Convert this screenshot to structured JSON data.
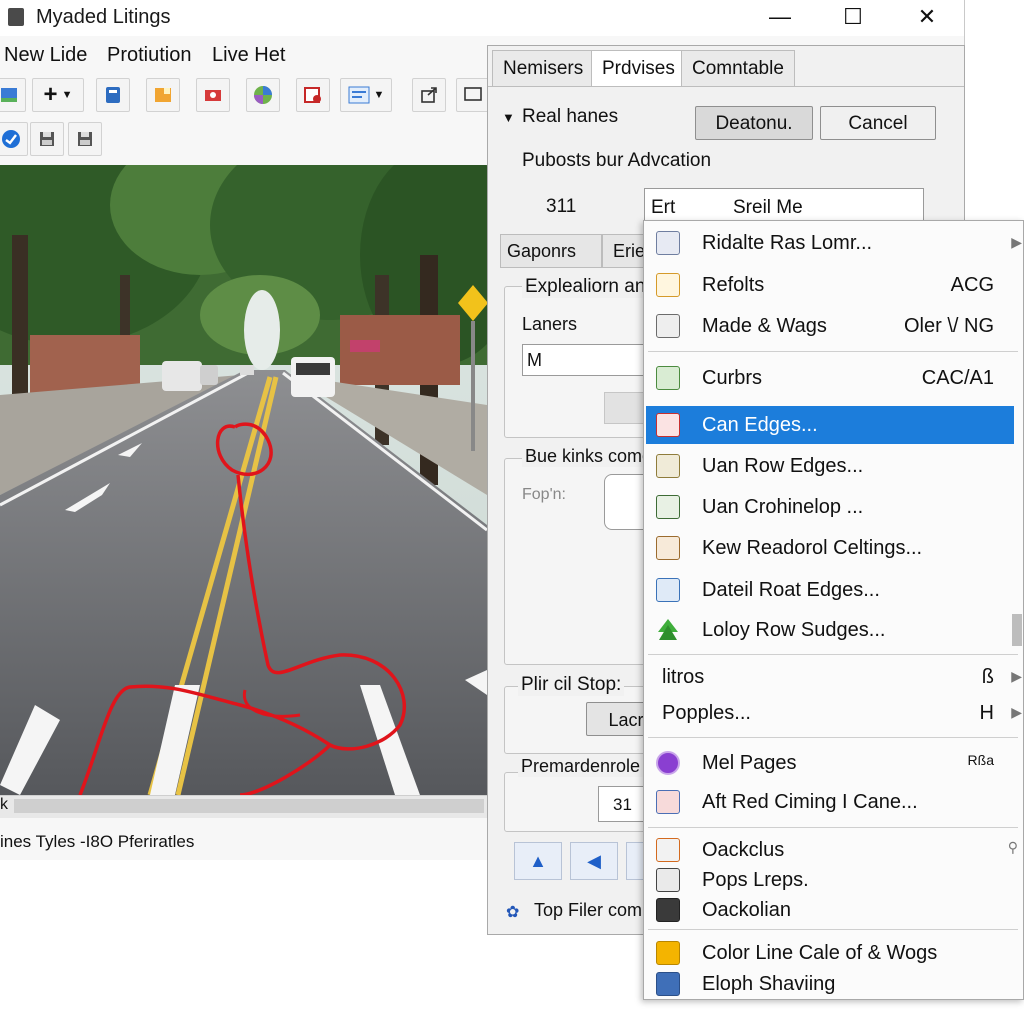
{
  "window": {
    "title": "Myaded Litings",
    "controls": {
      "minimize": "—",
      "maximize": "☐",
      "close": "✕"
    }
  },
  "menubar": [
    "New Lide",
    "Protiution",
    "Live Het"
  ],
  "status_bar": {
    "text": "ines Tyles -I8O Pferiratles",
    "scroll_left": "k"
  },
  "dialog": {
    "tabs": [
      "Nemisers",
      "Prdvises",
      "Comntable"
    ],
    "section_title": "Real hanes",
    "btn_primary": "Deatonu.",
    "btn_cancel": "Cancel",
    "subtitle": "Pubosts bur Advcation",
    "number_value": "311",
    "combo_left": "Ert",
    "combo_value": "Sreil Me",
    "subtabs": [
      "Gaponrs",
      "Erie"
    ],
    "group1_title": "Explealiorn an",
    "lanes_label": "Laners",
    "lanes_value": "M",
    "group2_title": "Bue kinks come",
    "fopn_label": "Fop'n:",
    "group3_title": "Plir cil Stop:",
    "lacro_btn": "Lacro",
    "group4_title": "Premardenrole",
    "group4_value": "31",
    "top_filer": "Top Filer com"
  },
  "context_menu": {
    "items": [
      {
        "label": "Ridalte Ras Lomr...",
        "shortcut": "",
        "icon": "grid-icon",
        "submenu": true
      },
      {
        "label": "Refolts",
        "shortcut": "ACG",
        "icon": "document-icon",
        "submenu": false
      },
      {
        "label": "Made & Wags",
        "shortcut": "Oler \\/ NG",
        "icon": "page-icon",
        "submenu": false
      },
      {
        "label": "Curbrs",
        "shortcut": "CAC/A1",
        "icon": "curb-icon",
        "submenu": false
      },
      {
        "label": "Can Edges...",
        "shortcut": "",
        "icon": "edges-icon",
        "submenu": false,
        "highlighted": true
      },
      {
        "label": "Uan Row Edges...",
        "shortcut": "",
        "icon": "row-edges-icon",
        "submenu": false
      },
      {
        "label": "Uan Crohinelop ...",
        "shortcut": "",
        "icon": "pencil-icon",
        "submenu": false
      },
      {
        "label": "Kew Readorol Celtings...",
        "shortcut": "",
        "icon": "road-icon",
        "submenu": false
      },
      {
        "label": "Dateil Roat Edges...",
        "shortcut": "",
        "icon": "road-edges-icon",
        "submenu": false
      },
      {
        "label": "Loloy Row Sudges...",
        "shortcut": "",
        "icon": "tree-icon",
        "submenu": false
      },
      {
        "label": "litros",
        "shortcut": "ß",
        "icon": "",
        "submenu": true
      },
      {
        "label": "Popples...",
        "shortcut": "H",
        "icon": "",
        "submenu": true
      },
      {
        "label": "Mel Pages",
        "shortcut": "Rßa",
        "icon": "circle-icon",
        "submenu": false
      },
      {
        "label": "Aft Red Ciming I Cane...",
        "shortcut": "",
        "icon": "image-icon",
        "submenu": false
      },
      {
        "label": "Oackclus",
        "shortcut": "",
        "icon": "stack-icon",
        "submenu": false
      },
      {
        "label": "Pops Lreps.",
        "shortcut": "",
        "icon": "car-icon",
        "submenu": false
      },
      {
        "label": "Oackolian",
        "shortcut": "",
        "icon": "film-icon",
        "submenu": false
      },
      {
        "label": "Color Line Cale of & Wogs",
        "shortcut": "",
        "icon": "color-icon",
        "submenu": false
      },
      {
        "label": "Eloph Shaviing",
        "shortcut": "",
        "icon": "bin-icon",
        "submenu": false
      }
    ]
  },
  "colors": {
    "highlight": "#1c7ddb",
    "annotation_red": "#e0141b"
  }
}
